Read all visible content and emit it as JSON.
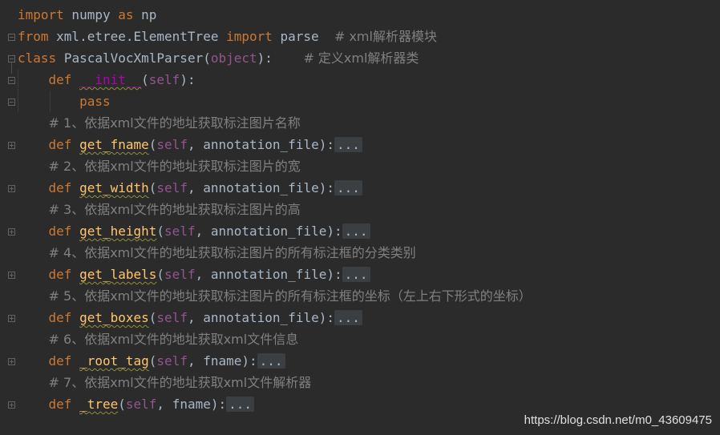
{
  "code": {
    "l1": {
      "k1": "import",
      "t1": " numpy ",
      "k2": "as",
      "t2": " np"
    },
    "l2": {
      "k1": "from",
      "t1": " xml.etree.ElementTree ",
      "k2": "import",
      "t2": " parse  ",
      "c1": "# xml解析器模块"
    },
    "l3": {
      "k1": "class",
      "t1": " ",
      "n1": "PascalVocXmlParser",
      "t2": "(",
      "s1": "object",
      "t3": "):    ",
      "c1": "# 定义xml解析器类"
    },
    "l4": {
      "k1": "def",
      "t1": " ",
      "n1": "__init__",
      "t2": "(",
      "s1": "self",
      "t3": "):"
    },
    "l5": {
      "k1": "pass"
    },
    "l6": {
      "c1": "# 1、依据xml文件的地址获取标注图片名称"
    },
    "l7": {
      "k1": "def",
      "t1": " ",
      "n1": "get_fname",
      "t2": "(",
      "s1": "self",
      "t3": ", annotation_file):",
      "f1": "..."
    },
    "l8": {
      "c1": "# 2、依据xml文件的地址获取标注图片的宽"
    },
    "l9": {
      "k1": "def",
      "t1": " ",
      "n1": "get_width",
      "t2": "(",
      "s1": "self",
      "t3": ", annotation_file):",
      "f1": "..."
    },
    "l10": {
      "c1": "# 3、依据xml文件的地址获取标注图片的高"
    },
    "l11": {
      "k1": "def",
      "t1": " ",
      "n1": "get_height",
      "t2": "(",
      "s1": "self",
      "t3": ", annotation_file):",
      "f1": "..."
    },
    "l12": {
      "c1": "# 4、依据xml文件的地址获取标注图片的所有标注框的分类类别"
    },
    "l13": {
      "k1": "def",
      "t1": " ",
      "n1": "get_labels",
      "t2": "(",
      "s1": "self",
      "t3": ", annotation_file):",
      "f1": "..."
    },
    "l14": {
      "c1": "# 5、依据xml文件的地址获取标注图片的所有标注框的坐标（左上右下形式的坐标）"
    },
    "l15": {
      "k1": "def",
      "t1": " ",
      "n1": "get_boxes",
      "t2": "(",
      "s1": "self",
      "t3": ", annotation_file):",
      "f1": "..."
    },
    "l16": {
      "c1": "# 6、依据xml文件的地址获取xml文件信息"
    },
    "l17": {
      "k1": "def",
      "t1": " ",
      "n1": "_root_tag",
      "t2": "(",
      "s1": "self",
      "t3": ", fname):",
      "f1": "..."
    },
    "l18": {
      "c1": "# 7、依据xml文件的地址获取xml文件解析器"
    },
    "l19": {
      "k1": "def",
      "t1": " ",
      "n1": "_tree",
      "t2": "(",
      "s1": "self",
      "t3": ", fname):",
      "f1": "..."
    }
  },
  "watermark": "https://blog.csdn.net/m0_43609475",
  "colors": {
    "background": "#2b2b2b",
    "keyword": "#cc7832",
    "self": "#94558d",
    "function": "#ffc66d",
    "dunder": "#b200b2",
    "comment": "#808080",
    "text": "#a9b7c6"
  }
}
